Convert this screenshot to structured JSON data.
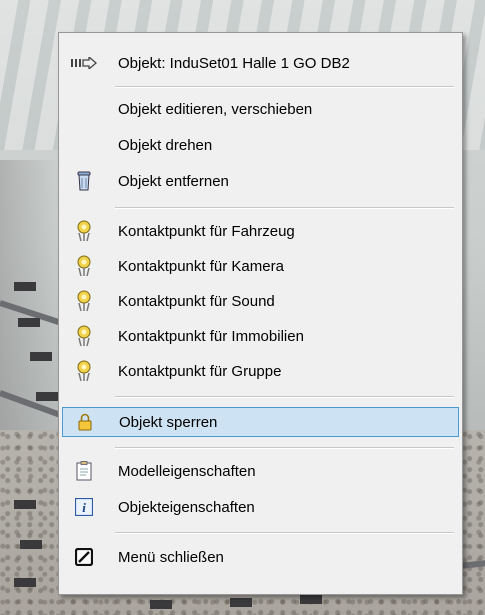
{
  "menu": {
    "header": {
      "label": "Objekt: InduSet01 Halle 1 GO DB2",
      "icon": "object-arrow-icon"
    },
    "items": [
      {
        "label": "Objekt editieren, verschieben",
        "icon": ""
      },
      {
        "label": "Objekt drehen",
        "icon": ""
      },
      {
        "label": "Objekt entfernen",
        "icon": "trash-icon"
      },
      {
        "label": "Kontaktpunkt für Fahrzeug",
        "icon": "contact-point-icon"
      },
      {
        "label": "Kontaktpunkt für Kamera",
        "icon": "contact-point-icon"
      },
      {
        "label": "Kontaktpunkt für Sound",
        "icon": "contact-point-icon"
      },
      {
        "label": "Kontaktpunkt für Immobilien",
        "icon": "contact-point-icon"
      },
      {
        "label": "Kontaktpunkt für Gruppe",
        "icon": "contact-point-icon"
      },
      {
        "label": "Objekt sperren",
        "icon": "lock-icon",
        "selected": true
      },
      {
        "label": "Modelleigenschaften",
        "icon": "clipboard-icon"
      },
      {
        "label": "Objekteigenschaften",
        "icon": "info-icon"
      },
      {
        "label": "Menü schließen",
        "icon": "close-menu-icon"
      }
    ]
  },
  "colors": {
    "menu_bg": "#f0f0f0",
    "highlight_bg": "#cde2f2",
    "highlight_border": "#4d9ad3"
  }
}
